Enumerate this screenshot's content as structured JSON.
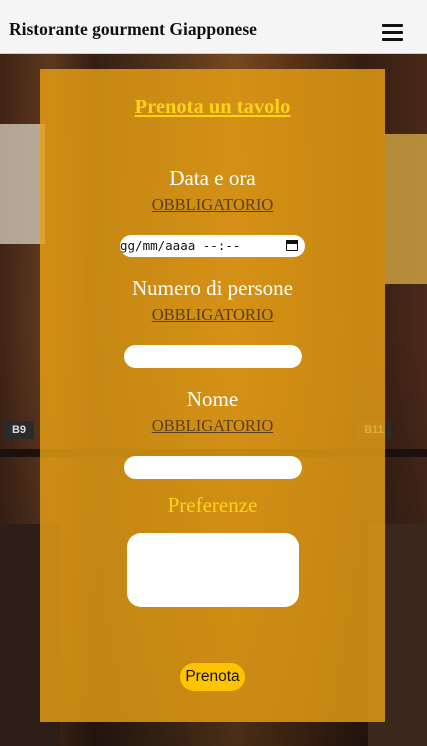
{
  "header": {
    "title": "Ristorante gourment Giapponese",
    "menu_icon": "hamburger-menu-icon"
  },
  "background": {
    "signs": [
      "B9",
      "B11"
    ]
  },
  "form": {
    "title": "Prenota un tavolo",
    "fields": [
      {
        "label": "Data e ora",
        "required_text": "OBBLIGATORIO",
        "value": "gg/mm/aaaa --:--",
        "type": "datetime-local"
      },
      {
        "label": "Numero di persone",
        "required_text": "OBBLIGATORIO",
        "value": "",
        "type": "number"
      },
      {
        "label": "Nome",
        "required_text": "OBBLIGATORIO",
        "value": "",
        "type": "text"
      }
    ],
    "preferences_label": "Preferenze",
    "preferences_value": "",
    "submit_label": "Prenota"
  },
  "colors": {
    "card": "#e8a014",
    "accent_yellow": "#ffd21a",
    "button": "#ffc400",
    "header_bg": "#f5f5f5"
  }
}
